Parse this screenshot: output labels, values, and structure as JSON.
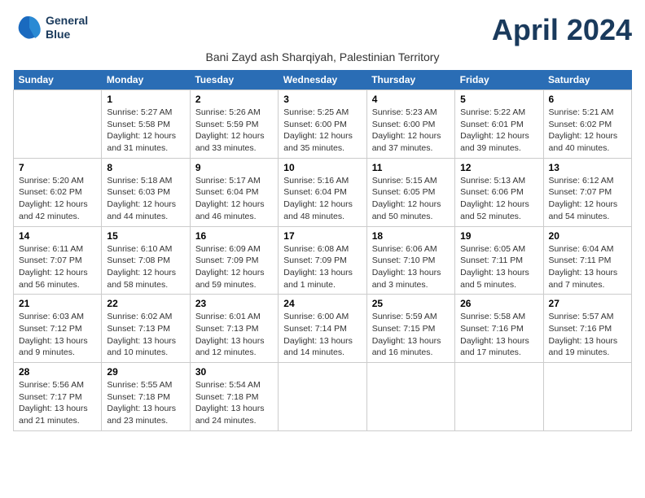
{
  "header": {
    "logo_line1": "General",
    "logo_line2": "Blue",
    "month": "April 2024",
    "location": "Bani Zayd ash Sharqiyah, Palestinian Territory"
  },
  "weekdays": [
    "Sunday",
    "Monday",
    "Tuesday",
    "Wednesday",
    "Thursday",
    "Friday",
    "Saturday"
  ],
  "weeks": [
    [
      {
        "day": "",
        "info": ""
      },
      {
        "day": "1",
        "info": "Sunrise: 5:27 AM\nSunset: 5:58 PM\nDaylight: 12 hours\nand 31 minutes."
      },
      {
        "day": "2",
        "info": "Sunrise: 5:26 AM\nSunset: 5:59 PM\nDaylight: 12 hours\nand 33 minutes."
      },
      {
        "day": "3",
        "info": "Sunrise: 5:25 AM\nSunset: 6:00 PM\nDaylight: 12 hours\nand 35 minutes."
      },
      {
        "day": "4",
        "info": "Sunrise: 5:23 AM\nSunset: 6:00 PM\nDaylight: 12 hours\nand 37 minutes."
      },
      {
        "day": "5",
        "info": "Sunrise: 5:22 AM\nSunset: 6:01 PM\nDaylight: 12 hours\nand 39 minutes."
      },
      {
        "day": "6",
        "info": "Sunrise: 5:21 AM\nSunset: 6:02 PM\nDaylight: 12 hours\nand 40 minutes."
      }
    ],
    [
      {
        "day": "7",
        "info": "Sunrise: 5:20 AM\nSunset: 6:02 PM\nDaylight: 12 hours\nand 42 minutes."
      },
      {
        "day": "8",
        "info": "Sunrise: 5:18 AM\nSunset: 6:03 PM\nDaylight: 12 hours\nand 44 minutes."
      },
      {
        "day": "9",
        "info": "Sunrise: 5:17 AM\nSunset: 6:04 PM\nDaylight: 12 hours\nand 46 minutes."
      },
      {
        "day": "10",
        "info": "Sunrise: 5:16 AM\nSunset: 6:04 PM\nDaylight: 12 hours\nand 48 minutes."
      },
      {
        "day": "11",
        "info": "Sunrise: 5:15 AM\nSunset: 6:05 PM\nDaylight: 12 hours\nand 50 minutes."
      },
      {
        "day": "12",
        "info": "Sunrise: 5:13 AM\nSunset: 6:06 PM\nDaylight: 12 hours\nand 52 minutes."
      },
      {
        "day": "13",
        "info": "Sunrise: 6:12 AM\nSunset: 7:07 PM\nDaylight: 12 hours\nand 54 minutes."
      }
    ],
    [
      {
        "day": "14",
        "info": "Sunrise: 6:11 AM\nSunset: 7:07 PM\nDaylight: 12 hours\nand 56 minutes."
      },
      {
        "day": "15",
        "info": "Sunrise: 6:10 AM\nSunset: 7:08 PM\nDaylight: 12 hours\nand 58 minutes."
      },
      {
        "day": "16",
        "info": "Sunrise: 6:09 AM\nSunset: 7:09 PM\nDaylight: 12 hours\nand 59 minutes."
      },
      {
        "day": "17",
        "info": "Sunrise: 6:08 AM\nSunset: 7:09 PM\nDaylight: 13 hours\nand 1 minute."
      },
      {
        "day": "18",
        "info": "Sunrise: 6:06 AM\nSunset: 7:10 PM\nDaylight: 13 hours\nand 3 minutes."
      },
      {
        "day": "19",
        "info": "Sunrise: 6:05 AM\nSunset: 7:11 PM\nDaylight: 13 hours\nand 5 minutes."
      },
      {
        "day": "20",
        "info": "Sunrise: 6:04 AM\nSunset: 7:11 PM\nDaylight: 13 hours\nand 7 minutes."
      }
    ],
    [
      {
        "day": "21",
        "info": "Sunrise: 6:03 AM\nSunset: 7:12 PM\nDaylight: 13 hours\nand 9 minutes."
      },
      {
        "day": "22",
        "info": "Sunrise: 6:02 AM\nSunset: 7:13 PM\nDaylight: 13 hours\nand 10 minutes."
      },
      {
        "day": "23",
        "info": "Sunrise: 6:01 AM\nSunset: 7:13 PM\nDaylight: 13 hours\nand 12 minutes."
      },
      {
        "day": "24",
        "info": "Sunrise: 6:00 AM\nSunset: 7:14 PM\nDaylight: 13 hours\nand 14 minutes."
      },
      {
        "day": "25",
        "info": "Sunrise: 5:59 AM\nSunset: 7:15 PM\nDaylight: 13 hours\nand 16 minutes."
      },
      {
        "day": "26",
        "info": "Sunrise: 5:58 AM\nSunset: 7:16 PM\nDaylight: 13 hours\nand 17 minutes."
      },
      {
        "day": "27",
        "info": "Sunrise: 5:57 AM\nSunset: 7:16 PM\nDaylight: 13 hours\nand 19 minutes."
      }
    ],
    [
      {
        "day": "28",
        "info": "Sunrise: 5:56 AM\nSunset: 7:17 PM\nDaylight: 13 hours\nand 21 minutes."
      },
      {
        "day": "29",
        "info": "Sunrise: 5:55 AM\nSunset: 7:18 PM\nDaylight: 13 hours\nand 23 minutes."
      },
      {
        "day": "30",
        "info": "Sunrise: 5:54 AM\nSunset: 7:18 PM\nDaylight: 13 hours\nand 24 minutes."
      },
      {
        "day": "",
        "info": ""
      },
      {
        "day": "",
        "info": ""
      },
      {
        "day": "",
        "info": ""
      },
      {
        "day": "",
        "info": ""
      }
    ]
  ]
}
